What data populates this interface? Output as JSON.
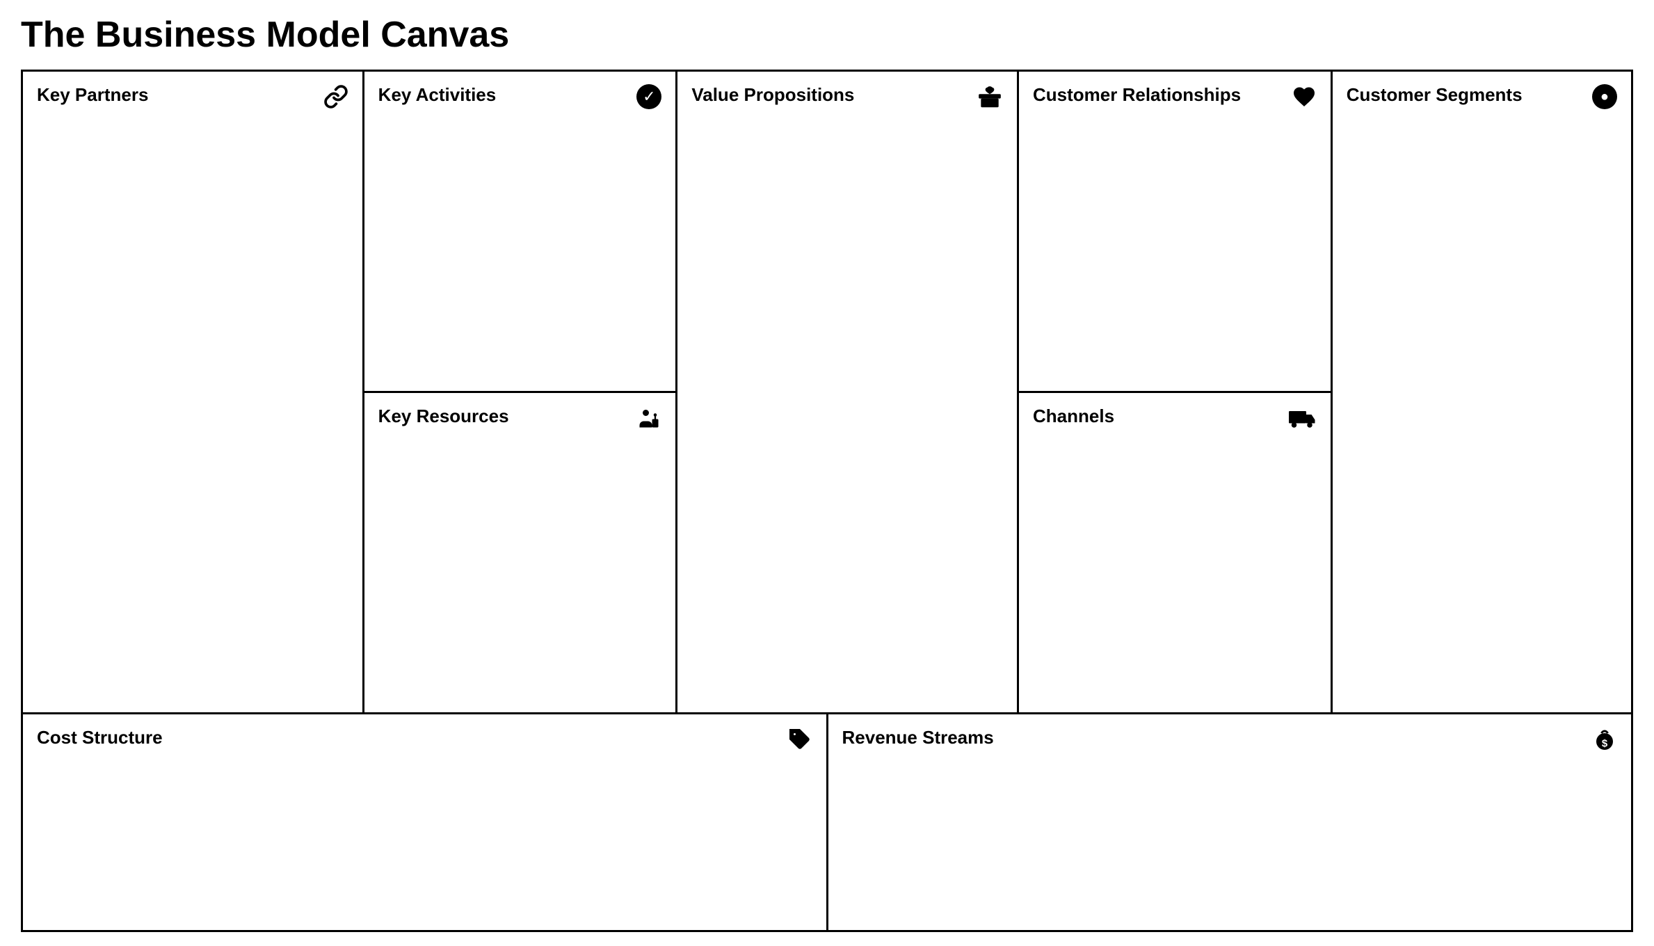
{
  "page": {
    "title": "The Business Model Canvas"
  },
  "cells": {
    "key_partners": {
      "title": "Key Partners",
      "icon": "link"
    },
    "key_activities": {
      "title": "Key Activities",
      "icon": "check-circle"
    },
    "key_resources": {
      "title": "Key Resources",
      "icon": "worker"
    },
    "value_propositions": {
      "title": "Value Propositions",
      "icon": "gift"
    },
    "customer_relationships": {
      "title": "Customer Relationships",
      "icon": "heart"
    },
    "channels": {
      "title": "Channels",
      "icon": "truck"
    },
    "customer_segments": {
      "title": "Customer Segments",
      "icon": "person"
    },
    "cost_structure": {
      "title": "Cost Structure",
      "icon": "tag"
    },
    "revenue_streams": {
      "title": "Revenue Streams",
      "icon": "moneybag"
    }
  }
}
